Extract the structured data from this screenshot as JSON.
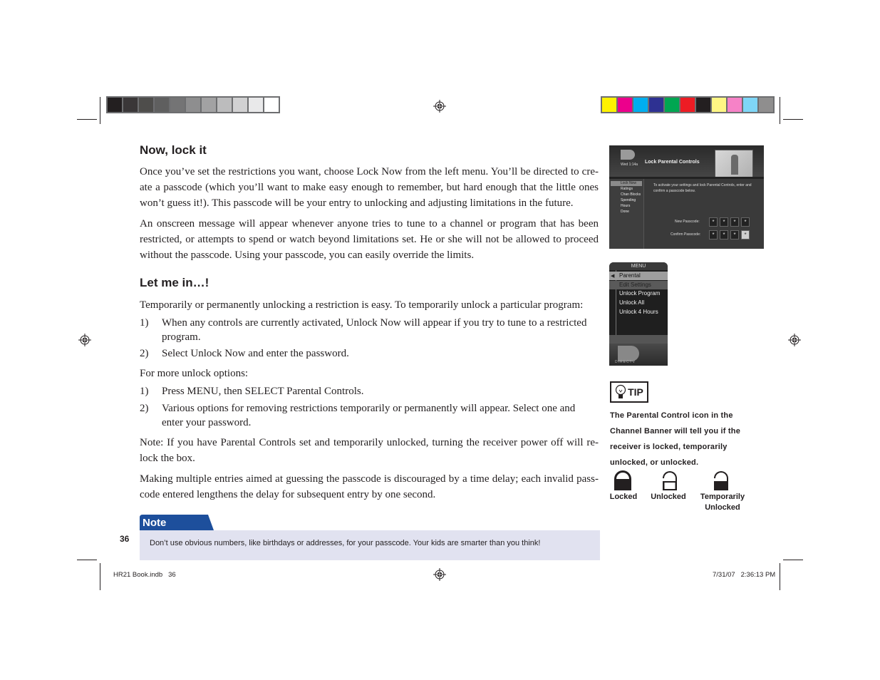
{
  "print_marks": {
    "gray_bar": [
      "#231f20",
      "#3a3738",
      "#4e4d4b",
      "#5f5f5f",
      "#747475",
      "#8e8e8f",
      "#a2a2a3",
      "#bcbcbd",
      "#d1d1d2",
      "#e9e9ea",
      "#ffffff"
    ],
    "color_bar": [
      "#fff200",
      "#ec008c",
      "#00aeef",
      "#2e3192",
      "#00a651",
      "#ed1c24",
      "#231f20",
      "#fff684",
      "#f682c7",
      "#7fd6f7",
      "#8f8e8e"
    ]
  },
  "section1": {
    "heading": "Now, lock it",
    "paragraphs": [
      "Once you’ve set the restrictions you want, choose Lock Now from the left menu. You’ll be directed to cre­ate a passcode (which you’ll want to make easy enough to remember, but hard enough that the little ones won’t guess it!). This passcode will be your entry to unlocking and adjusting limitations in the future.",
      "An onscreen message will appear whenever anyone tries to tune to a channel or program that has been restricted, or attempts to spend or watch beyond limitations set. He or she will not be allowed to proceed without the passcode. Using your passcode, you can easily override the limits."
    ]
  },
  "section2": {
    "heading": "Let me in…!",
    "intro": "Temporarily or permanently unlocking a restriction is easy. To temporarily unlock a particular program:",
    "steps_a": [
      {
        "num": "1)",
        "text": "When any controls are currently activated, Unlock Now will appear if you try to tune to a restricted program."
      },
      {
        "num": "2)",
        "text": "Select Unlock Now and enter the password."
      }
    ],
    "more_label": "For more unlock options:",
    "steps_b": [
      {
        "num": "1)",
        "text": "Press MENU, then SELECT Parental Controls."
      },
      {
        "num": "2)",
        "text": "Various options for removing restrictions temporarily or permanently will appear. Select one and enter your password."
      }
    ],
    "note_para": "Note: If you have Parental Controls set and temporarily unlocked, turning the receiver power off will re­lock the box.",
    "delay_para": "Making multiple entries aimed at guessing the passcode is discouraged by a time delay; each invalid pass­code entered lengthens the delay for subsequent entry by one second."
  },
  "tv_screenshot": {
    "title": "Lock Parental Controls",
    "time": "Wed 1:14a",
    "menu": [
      "Lock Now",
      "Ratings",
      "Chan Blocks",
      "Spending",
      "Hours",
      "Done"
    ],
    "instruction": "To activate your settings and lock Parental Controls, enter and confirm a passcode below.",
    "new_passcode_label": "New Passcode:",
    "confirm_passcode_label": "Confirm Passcode:",
    "mask": "*"
  },
  "menu_screenshot": {
    "title": "MENU",
    "items": [
      "Parental",
      "Edit Settings",
      "Unlock Program",
      "Unlock All",
      "Unlock 4 Hours"
    ],
    "brand": "DIRECTV"
  },
  "tip": {
    "label": "TIP",
    "text": "The Parental Control icon in the Channel Banner will tell you if the receiver is locked, temporarily unlocked, or unlocked.",
    "icons": [
      {
        "name": "locked",
        "label": "Locked"
      },
      {
        "name": "unlocked",
        "label": "Unlocked"
      },
      {
        "name": "temporarily-unlocked",
        "label": "Temporarily Unlocked"
      }
    ]
  },
  "note": {
    "title": "Note",
    "text": "Don’t use obvious numbers, like birthdays or addresses, for your passcode. Your kids are smarter than you think!",
    "color": "#1d4f9c",
    "bg": "#e1e2f0"
  },
  "page_number": "36",
  "slug": {
    "file": "HR21 Book.indb   36",
    "timestamp": "7/31/07   2:36:13 PM"
  }
}
